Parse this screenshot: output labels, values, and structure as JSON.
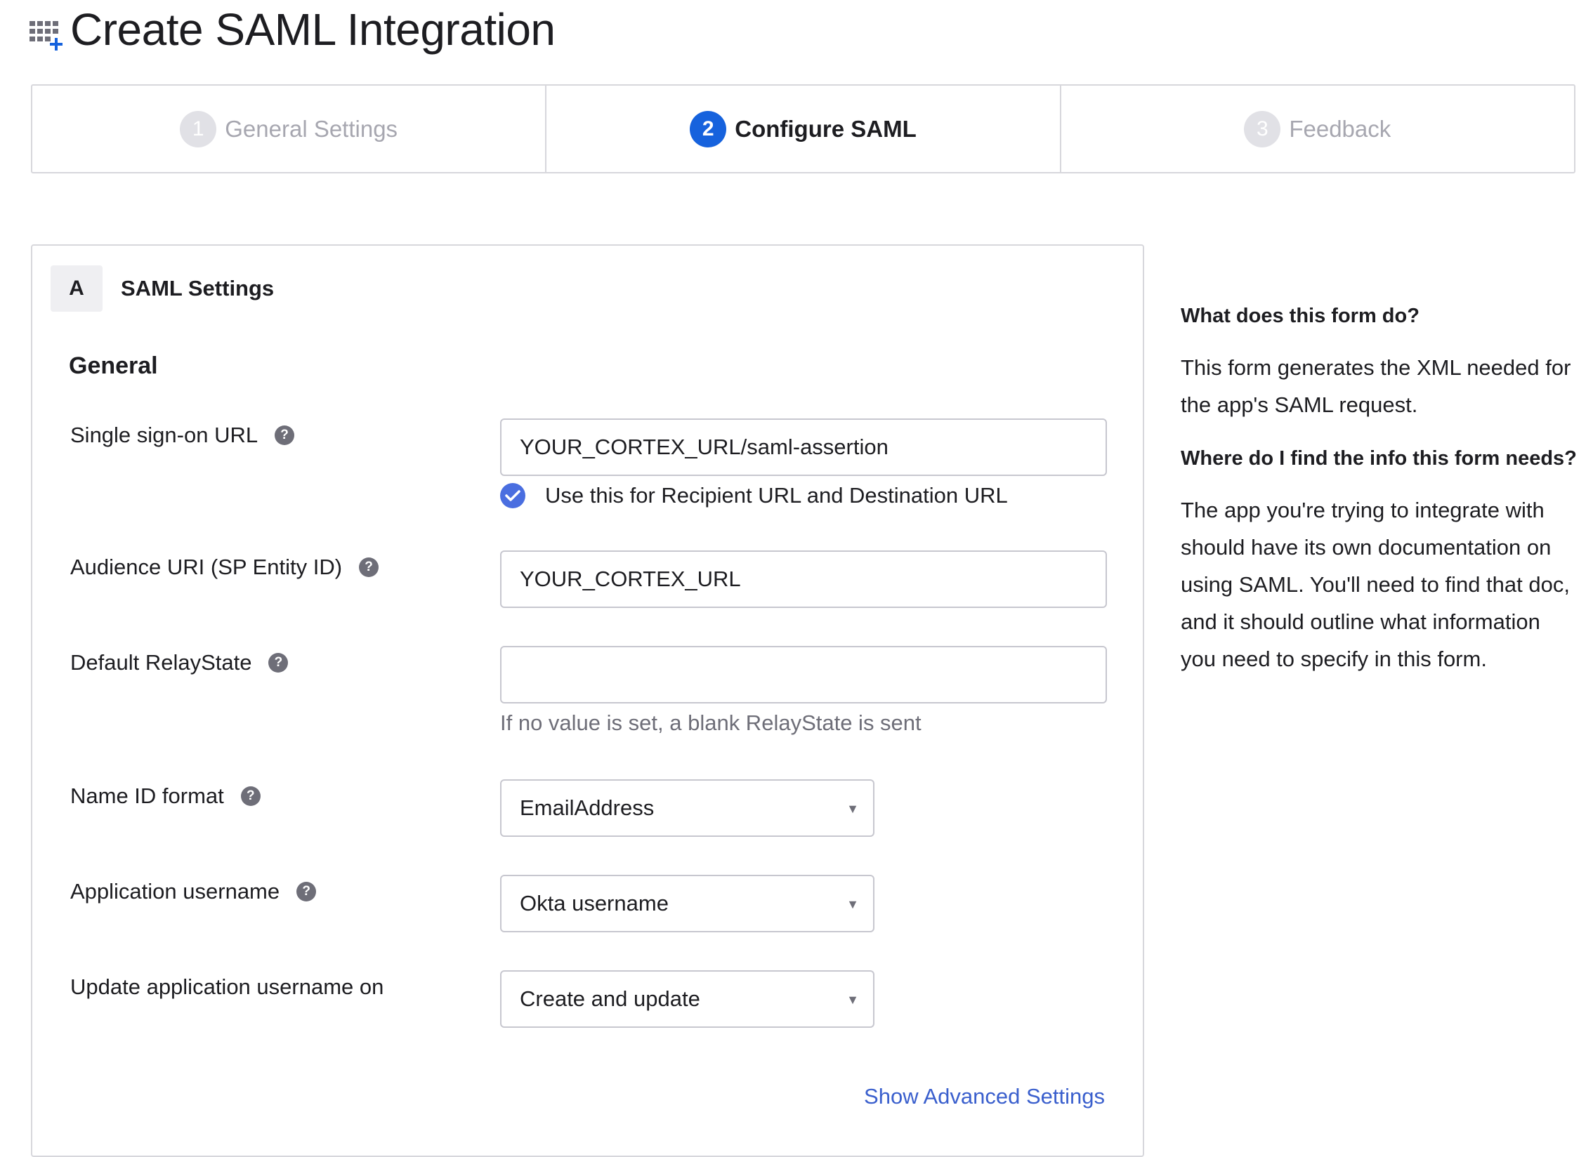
{
  "header": {
    "title": "Create SAML Integration",
    "icon": "add-app-icon"
  },
  "wizard": {
    "steps": [
      {
        "number": "1",
        "label": "General Settings",
        "state": "inactive"
      },
      {
        "number": "2",
        "label": "Configure SAML",
        "state": "active"
      },
      {
        "number": "3",
        "label": "Feedback",
        "state": "inactive"
      }
    ]
  },
  "section": {
    "letter": "A",
    "title": "SAML Settings",
    "group_title": "General"
  },
  "fields": {
    "sso_url": {
      "label": "Single sign-on URL",
      "value": "YOUR_CORTEX_URL/saml-assertion",
      "help_icon": "?"
    },
    "recipient_checkbox": {
      "label": "Use this for Recipient URL and Destination URL",
      "checked": true
    },
    "audience_uri": {
      "label": "Audience URI (SP Entity ID)",
      "value": "YOUR_CORTEX_URL",
      "help_icon": "?"
    },
    "relay_state": {
      "label": "Default RelayState",
      "value": "",
      "hint": "If no value is set, a blank RelayState is sent",
      "help_icon": "?"
    },
    "name_id_format": {
      "label": "Name ID format",
      "value": "EmailAddress",
      "help_icon": "?"
    },
    "app_username": {
      "label": "Application username",
      "value": "Okta username",
      "help_icon": "?"
    },
    "update_username_on": {
      "label": "Update application username on",
      "value": "Create and update"
    }
  },
  "advanced_link": "Show Advanced Settings",
  "sidebar": {
    "q1": "What does this form do?",
    "a1": "This form generates the XML needed for the app's SAML request.",
    "q2": "Where do I find the info this form needs?",
    "a2": "The app you're trying to integrate with should have its own documentation on using SAML. You'll need to find that doc, and it should outline what information you need to specify in this form."
  },
  "colors": {
    "accent": "#1662dd",
    "checkbox": "#4a6ee0",
    "link": "#3a5fcd",
    "border": "#d7d7dc"
  }
}
